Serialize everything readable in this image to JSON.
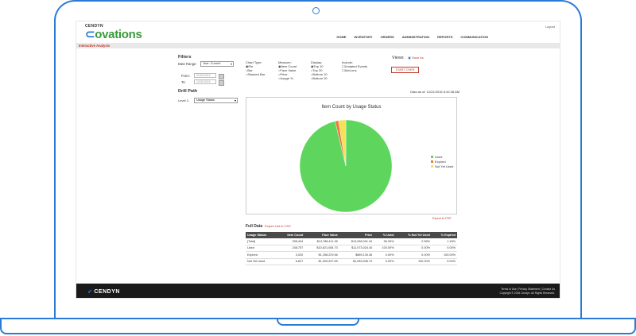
{
  "brand": {
    "top": "CENDYN",
    "name": "ovations"
  },
  "header": {
    "logout": "Logout"
  },
  "nav": [
    "HOME",
    "INVENTORY",
    "ORDERS",
    "ADMINISTRATION",
    "REPORTS",
    "COMMUNICATION"
  ],
  "section_title": "Interactive Analysis",
  "filters": {
    "title": "Filters",
    "date_range_label": "Date Range:",
    "date_range_value": "Year: Current",
    "from_label": "From:",
    "from_value": "01/01/2016",
    "to_label": "To:",
    "to_value": "12/31/2016"
  },
  "chart_type": {
    "label": "Chart Type:",
    "options": [
      "Pie",
      "Bar",
      "Stacked Bar"
    ]
  },
  "measure": {
    "label": "Measure:",
    "options": [
      "Item Count",
      "Face Value",
      "Price",
      "Usage %"
    ]
  },
  "display": {
    "label": "Display:",
    "options": [
      "Top 10",
      "Top 20",
      "Bottom 10",
      "Bottom 20"
    ]
  },
  "include": {
    "label": "Include:",
    "options": [
      "Undated Events",
      "Add-ons"
    ]
  },
  "views": {
    "title": "Views",
    "save": "Save As"
  },
  "start_over": "START OVER",
  "drill": {
    "title": "Drill Path",
    "level_label": "Level 1:",
    "level_value": "Usage Status"
  },
  "data_as_of": "Data as of: 12/21/2016 6:42:48 AM",
  "export_pdf": "Export to PDF",
  "full_data": {
    "title": "Full Data",
    "export": "Export List to CSV"
  },
  "table": {
    "headers": [
      "Usage Status",
      "Item Count",
      "Face Value",
      "Price",
      "% Used",
      "% Not Yet Used",
      "% Expired"
    ],
    "rows": [
      [
        "[Total]",
        "258,404",
        "$13,788,411.95",
        "$13,066,091.34",
        "96.26%",
        "2.56%",
        "1.18%"
      ],
      [
        "Used",
        "248,757",
        "$10,621,084.70",
        "$11,073,024.40",
        "100.00%",
        "0.00%",
        "0.00%"
      ],
      [
        "Expired",
        "3,020",
        "$1,258,229.56",
        "$889,130.36",
        "0.00%",
        "0.00%",
        "100.00%"
      ],
      [
        "Not Yet Used",
        "6,627",
        "$1,909,097.69",
        "$1,083,936.70",
        "0.00%",
        "100.00%",
        "0.00%"
      ]
    ]
  },
  "footer": {
    "logo": "CENDYN",
    "links": "Terms of Use | Privacy Statement | Contact Us",
    "copyright": "Copyright © 2016 Cendyn. All Rights Reserved."
  },
  "colors": {
    "used": "#5ed65e",
    "expired": "#f07a3a",
    "not_yet_used": "#f4e15a"
  },
  "chart_data": {
    "type": "pie",
    "title": "Item Count by Usage Status",
    "categories": [
      "Used",
      "Expired",
      "Not Yet Used"
    ],
    "values": [
      248757,
      3020,
      6627
    ],
    "legend_position": "right"
  }
}
